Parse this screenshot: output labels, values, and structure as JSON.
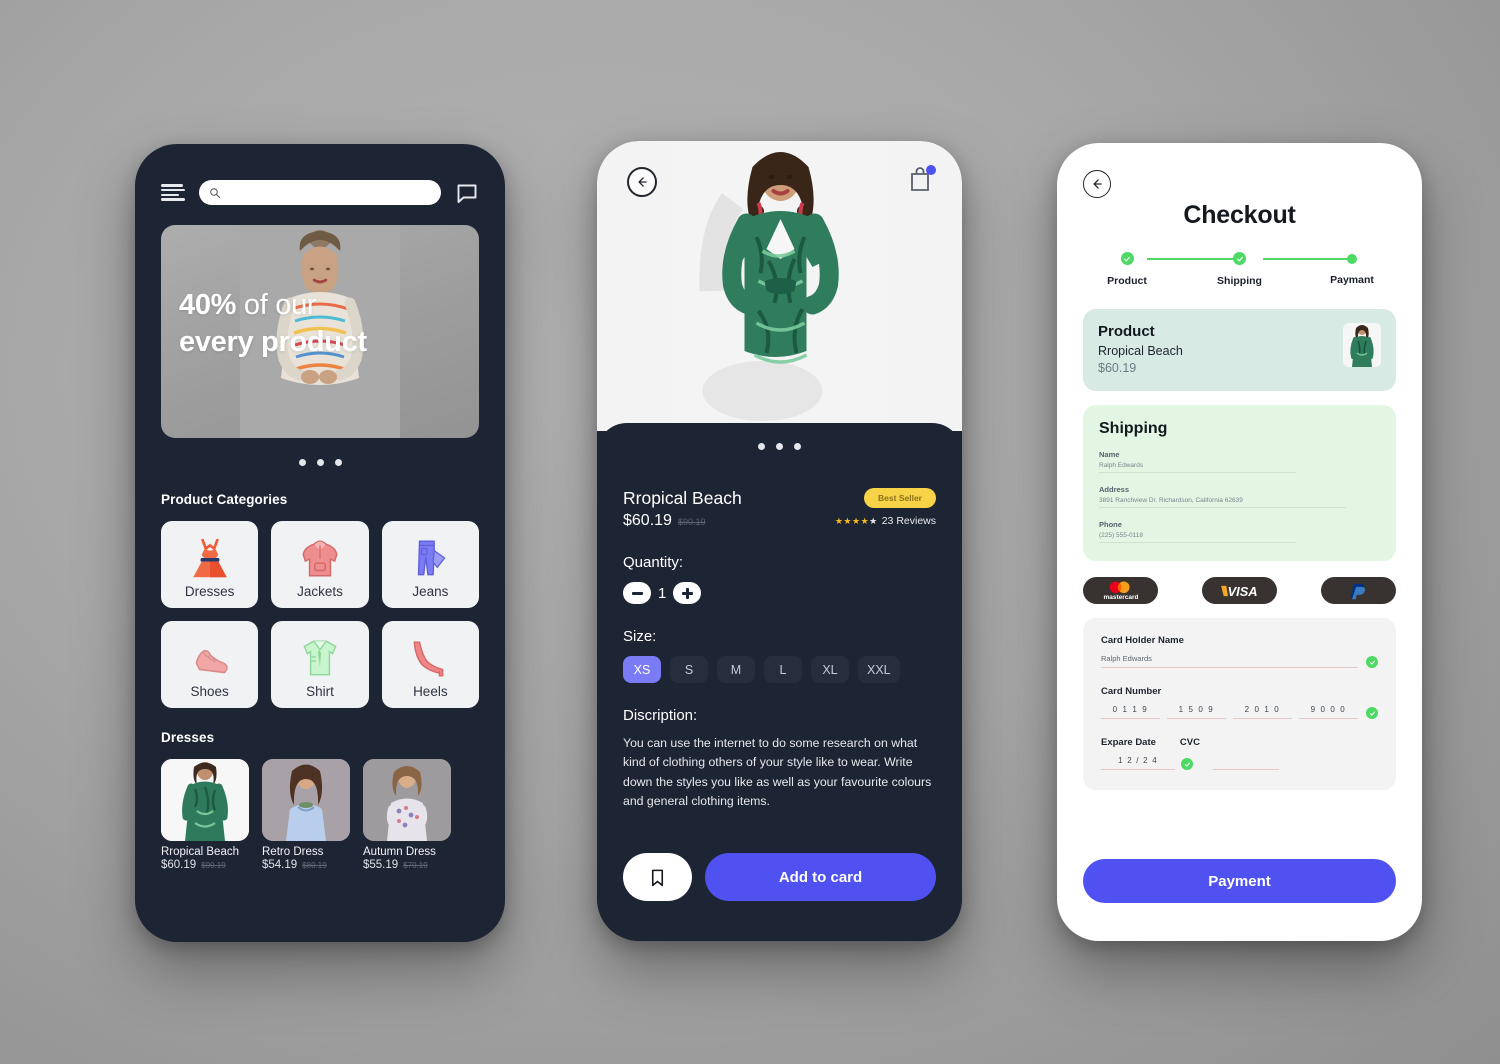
{
  "home": {
    "menu_icon": "hamburger-menu-icon",
    "search": {
      "value": "",
      "placeholder": ""
    },
    "chat_icon": "chat-bubble-icon",
    "hero": {
      "highlight": "40%",
      "line1_rest": " of our",
      "line2": "every product"
    },
    "carousel_dots": 3,
    "categories_title": "Product Categories",
    "categories": [
      {
        "label": "Dresses",
        "icon": "dress-icon"
      },
      {
        "label": "Jackets",
        "icon": "hoodie-icon"
      },
      {
        "label": "Jeans",
        "icon": "jeans-icon"
      },
      {
        "label": "Shoes",
        "icon": "sneaker-icon"
      },
      {
        "label": "Shirt",
        "icon": "shirt-icon"
      },
      {
        "label": "Heels",
        "icon": "high-heel-icon"
      }
    ],
    "dresses_title": "Dresses",
    "products": [
      {
        "name": "Rropical Beach",
        "price": "$60.19",
        "old_price": "$90.19"
      },
      {
        "name": "Retro Dress",
        "price": "$54.19",
        "old_price": "$80.19"
      },
      {
        "name": "Autumn Dress",
        "price": "$55.19",
        "old_price": "$70.19"
      }
    ]
  },
  "detail": {
    "back_icon": "back-arrow-icon",
    "cart_icon": "shopping-bag-icon",
    "sheet_dots": 3,
    "product_name": "Rropical Beach",
    "price": "$60.19",
    "old_price": "$90.19",
    "badge": "Best Seller",
    "stars_filled": 4,
    "stars_total": 5,
    "reviews": "23 Reviews",
    "quantity_label": "Quantity:",
    "quantity_value": "1",
    "minus_icon": "minus-icon",
    "plus_icon": "plus-icon",
    "size_label": "Size:",
    "sizes": [
      "XS",
      "S",
      "M",
      "L",
      "XL",
      "XXL"
    ],
    "selected_size": "XS",
    "description_label": "Discription:",
    "description": "You can use the internet to do some research on what kind of clothing others of your style like to wear. Write down the styles you like as well as your favourite colours and general clothing items.",
    "bookmark_icon": "bookmark-icon",
    "add_to_cart": "Add to card"
  },
  "checkout": {
    "back_icon": "back-arrow-icon",
    "title": "Checkout",
    "steps": [
      {
        "label": "Product",
        "state": "complete"
      },
      {
        "label": "Shipping",
        "state": "complete"
      },
      {
        "label": "Paymant",
        "state": "current"
      }
    ],
    "product_card": {
      "title": "Product",
      "name": "Rropical Beach",
      "price": "$60.19"
    },
    "shipping_card": {
      "title": "Shipping",
      "fields": [
        {
          "label": "Name",
          "value": "Ralph Edwards"
        },
        {
          "label": "Address",
          "value": "3891 Ranchview Dr. Richardson, California 62639"
        },
        {
          "label": "Phone",
          "value": "(225) 555-0118"
        }
      ]
    },
    "payment_methods": [
      {
        "name": "mastercard",
        "icon": "mastercard-logo"
      },
      {
        "name": "VISA",
        "icon": "visa-logo"
      },
      {
        "name": "PayPal",
        "icon": "paypal-logo"
      }
    ],
    "form": {
      "holder_label": "Card Holder Name",
      "holder_value": "Ralph Edwards",
      "number_label": "Card Number",
      "number_segments": [
        "0 1 1 9",
        "1 5 0 9",
        "2 0 1 0",
        "9 0 0 0"
      ],
      "expire_label": "Expare Date",
      "expire_value": "1 2 / 2 4",
      "cvc_label": "CVC",
      "cvc_value": "",
      "valid_icon": "check-circle-icon"
    },
    "pay_button": "Payment"
  },
  "colors": {
    "dark": "#1d2433",
    "accent": "#4f52f0",
    "size_active": "#7b7cf5",
    "badge": "#f8d348",
    "green": "#4ed964",
    "product_card": "#d7eae4",
    "shipping_card": "#e3f6e4"
  }
}
